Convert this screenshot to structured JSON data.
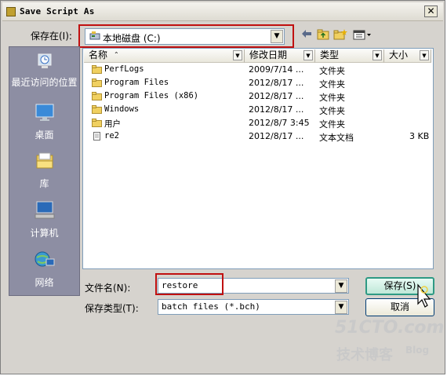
{
  "window": {
    "title": "Save Script As"
  },
  "location": {
    "label": "保存在(I):",
    "value": "本地磁盘 (C:)"
  },
  "places": [
    {
      "label": "最近访问的位置",
      "icon": "recent-places-icon"
    },
    {
      "label": "桌面",
      "icon": "desktop-icon"
    },
    {
      "label": "库",
      "icon": "library-icon"
    },
    {
      "label": "计算机",
      "icon": "computer-icon"
    },
    {
      "label": "网络",
      "icon": "network-icon"
    }
  ],
  "columns": {
    "name": "名称",
    "date": "修改日期",
    "type": "类型",
    "size": "大小"
  },
  "files": [
    {
      "name": "PerfLogs",
      "date": "2009/7/14 ...",
      "type": "文件夹",
      "size": "",
      "kind": "folder"
    },
    {
      "name": "Program Files",
      "date": "2012/8/17 ...",
      "type": "文件夹",
      "size": "",
      "kind": "folder"
    },
    {
      "name": "Program Files (x86)",
      "date": "2012/8/17 ...",
      "type": "文件夹",
      "size": "",
      "kind": "folder"
    },
    {
      "name": "Windows",
      "date": "2012/8/17 ...",
      "type": "文件夹",
      "size": "",
      "kind": "folder"
    },
    {
      "name": "用户",
      "date": "2012/8/7 3:45",
      "type": "文件夹",
      "size": "",
      "kind": "folder"
    },
    {
      "name": "re2",
      "date": "2012/8/17 ...",
      "type": "文本文档",
      "size": "3 KB",
      "kind": "document"
    }
  ],
  "filename": {
    "label": "文件名(N):",
    "value": "restore"
  },
  "filetype": {
    "label": "保存类型(T):",
    "value": "batch files (*.bch)"
  },
  "buttons": {
    "save": "保存(S)",
    "cancel": "取消"
  },
  "watermark": {
    "line1": "51CTO.com",
    "line2": "技术博客",
    "line3": "Blog"
  },
  "colors": {
    "highlight": "#c01010",
    "places_bg": "#8d8ea3",
    "save_border": "#2e9a84"
  }
}
